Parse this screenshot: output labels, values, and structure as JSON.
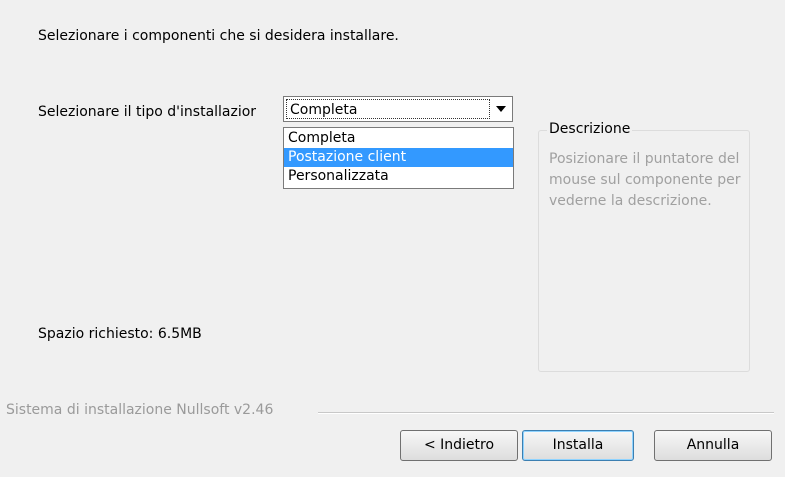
{
  "intro_text": "Selezionare i componenti che si desidera installare.",
  "install_type": {
    "label": "Selezionare il tipo d'installazior",
    "selected_value": "Completa",
    "options": [
      "Completa",
      "Postazione client",
      "Personalizzata"
    ],
    "highlighted_option": "Postazione client"
  },
  "description": {
    "title": "Descrizione",
    "text": "Posizionare il puntatore del mouse sul componente per vederne la descrizione."
  },
  "space_required": "Spazio richiesto: 6.5MB",
  "branding": "Sistema di installazione Nullsoft v2.46",
  "buttons": {
    "back": "< Indietro",
    "install": "Installa",
    "cancel": "Annulla"
  },
  "colors": {
    "highlight": "#3399ff",
    "window_bg": "#f0f0f0",
    "disabled_text": "#a0a0a0"
  }
}
